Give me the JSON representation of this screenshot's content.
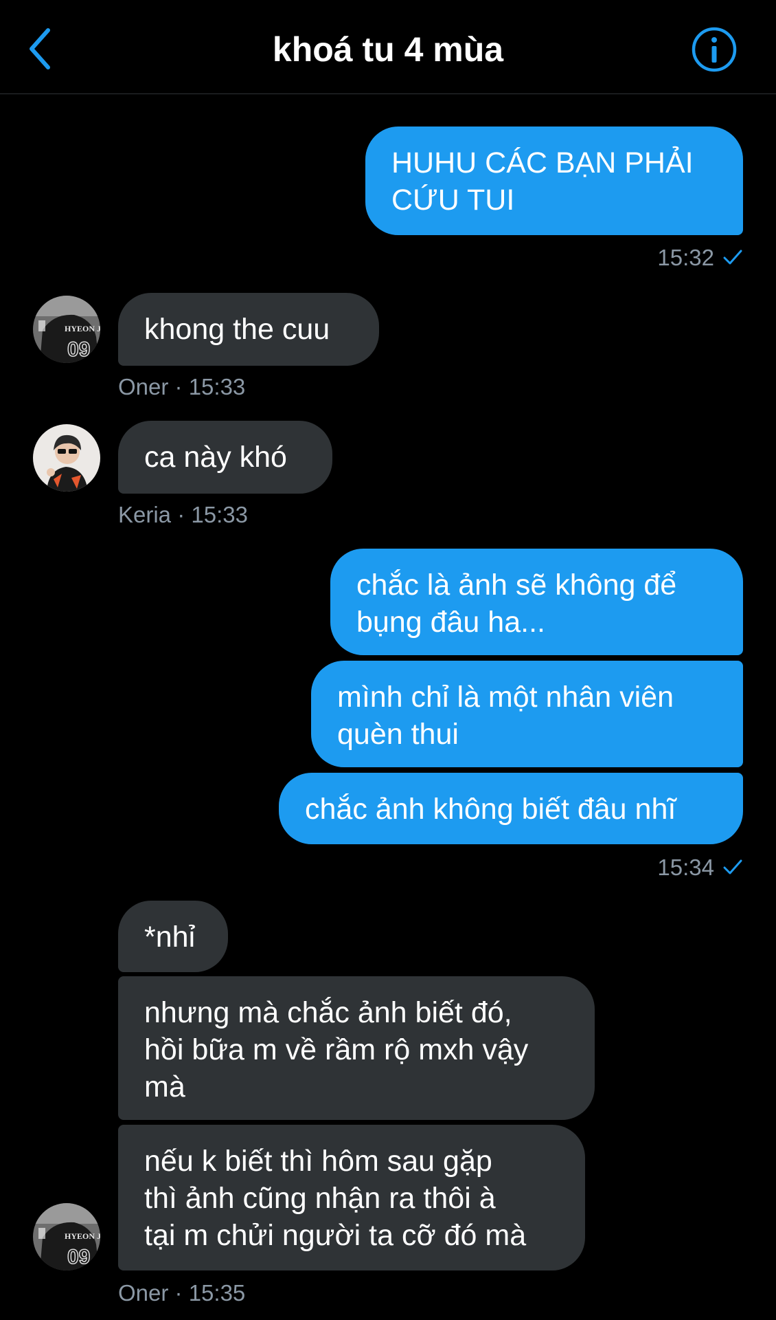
{
  "header": {
    "title": "khoá tu 4 mùa",
    "back_icon": "chevron-left-icon",
    "info_icon": "info-icon",
    "accent_color": "#1d9bf0"
  },
  "messages": [
    {
      "id": "m1",
      "direction": "out",
      "lines": [
        "HUHU CÁC BẠN PHẢI",
        "CỨU TUI"
      ]
    },
    {
      "id": "m2",
      "direction": "in",
      "sender": "Oner",
      "lines": [
        "khong the cuu"
      ]
    },
    {
      "id": "m3",
      "direction": "in",
      "sender": "Keria",
      "lines": [
        "ca này khó"
      ]
    },
    {
      "id": "m4",
      "direction": "out",
      "lines": [
        "chắc là ảnh sẽ không để",
        "bụng đâu ha..."
      ]
    },
    {
      "id": "m5",
      "direction": "out",
      "lines": [
        "mình chỉ là một nhân viên",
        "quèn thui"
      ]
    },
    {
      "id": "m6",
      "direction": "out",
      "lines": [
        "chắc ảnh không biết đâu nhĩ"
      ]
    },
    {
      "id": "m7",
      "direction": "in",
      "sender": "Oner",
      "lines": [
        "*nhỉ"
      ]
    },
    {
      "id": "m8",
      "direction": "in",
      "sender": "Oner",
      "lines": [
        "nhưng mà chắc ảnh biết đó,",
        "hồi bữa m về rầm rộ mxh vậy",
        "mà"
      ]
    },
    {
      "id": "m9",
      "direction": "in",
      "sender": "Oner",
      "lines": [
        "nếu k biết thì hôm sau gặp",
        "thì ảnh cũng nhận ra thôi à",
        "tại m chửi người ta cỡ đó mà"
      ]
    }
  ],
  "timestamps": {
    "t1": "15:32",
    "t2": "Oner · 15:33",
    "t3": "Keria · 15:33",
    "t4": "15:34",
    "t5": "Oner · 15:35"
  },
  "status_icon": "check-icon"
}
